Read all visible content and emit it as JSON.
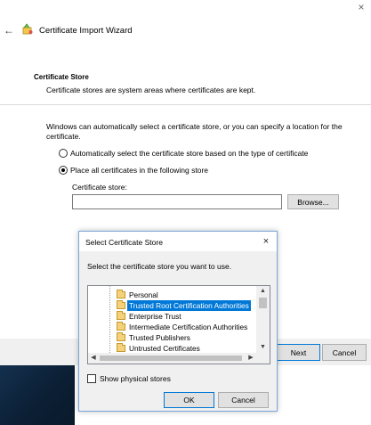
{
  "window": {
    "title": "Certificate Import Wizard",
    "close_glyph": "×",
    "back_glyph": "←"
  },
  "section": {
    "heading": "Certificate Store",
    "description": "Certificate stores are system areas where certificates are kept."
  },
  "intro": "Windows can automatically select a certificate store, or you can specify a location for the certificate.",
  "options": [
    {
      "label": "Automatically select the certificate store based on the type of certificate",
      "checked": false
    },
    {
      "label": "Place all certificates in the following store",
      "checked": true
    }
  ],
  "store": {
    "label": "Certificate store:",
    "value": "",
    "browse_label": "Browse..."
  },
  "footer": {
    "next_label": "Next",
    "cancel_label": "Cancel"
  },
  "dialog": {
    "title": "Select Certificate Store",
    "close_glyph": "×",
    "prompt": "Select the certificate store you want to use.",
    "stores": [
      {
        "label": "Personal",
        "selected": false
      },
      {
        "label": "Trusted Root Certification Authorities",
        "selected": true
      },
      {
        "label": "Enterprise Trust",
        "selected": false
      },
      {
        "label": "Intermediate Certification Authorities",
        "selected": false
      },
      {
        "label": "Trusted Publishers",
        "selected": false
      },
      {
        "label": "Untrusted Certificates",
        "selected": false
      }
    ],
    "show_physical_label": "Show physical stores",
    "show_physical_checked": false,
    "ok_label": "OK",
    "cancel_label": "Cancel"
  },
  "icons": {
    "wizard": "certificate-wizard-icon",
    "folder": "folder-icon"
  }
}
